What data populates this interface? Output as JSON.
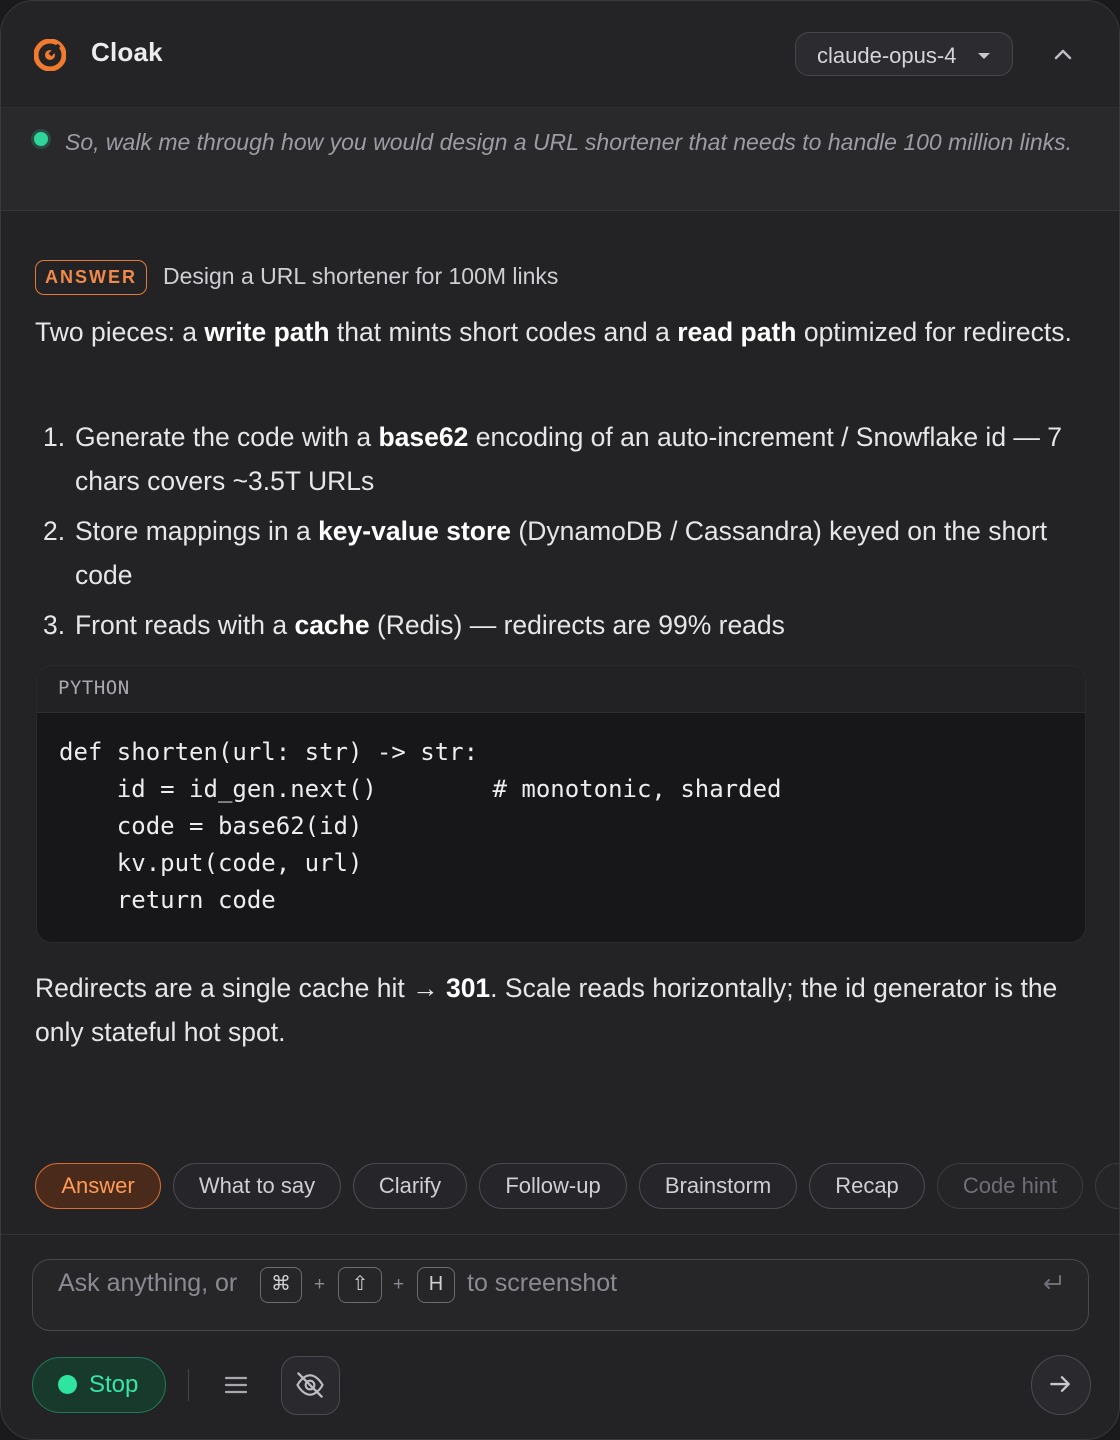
{
  "app": {
    "title": "Cloak"
  },
  "header": {
    "model": "claude-opus-4"
  },
  "transcript": {
    "text": "So, walk me through how you would design a URL shortener that needs to handle 100 million links."
  },
  "answer": {
    "badge": "ANSWER",
    "title": "Design a URL shortener for 100M links",
    "intro": {
      "t1": "Two pieces: a ",
      "b1": "write path",
      "t2": " that mints short codes and a ",
      "b2": "read path",
      "t3": " optimized for redirects."
    },
    "steps": [
      {
        "num": "1.",
        "t1": "Generate the code with a ",
        "b": "base62",
        "t2": " encoding of an auto-increment / Snowflake id — 7 chars covers ~3.5T URLs"
      },
      {
        "num": "2.",
        "t1": "Store mappings in a ",
        "b": "key-value store",
        "t2": " (DynamoDB / Cassandra) keyed on the short code"
      },
      {
        "num": "3.",
        "t1": "Front reads with a ",
        "b": "cache",
        "t2": " (Redis) — redirects are 99% reads"
      }
    ],
    "code": {
      "lang": "PYTHON",
      "text": "def shorten(url: str) -> str:\n    id = id_gen.next()        # monotonic, sharded\n    code = base62(id)\n    kv.put(code, url)\n    return code"
    },
    "outro": {
      "t1": "Redirects are a single cache hit → ",
      "b": "301",
      "t2": ". Scale reads horizontally; the id generator is the only stateful hot spot."
    }
  },
  "chips": [
    "Answer",
    "What to say",
    "Clarify",
    "Follow-up",
    "Brainstorm",
    "Recap",
    "Code hint"
  ],
  "composer": {
    "ph_before": "Ask anything, or",
    "key_cmd": "⌘",
    "plus": "+",
    "key_shift": "⇧",
    "key_h": "H",
    "ph_after": "to screenshot"
  },
  "footer": {
    "stop": "Stop"
  }
}
